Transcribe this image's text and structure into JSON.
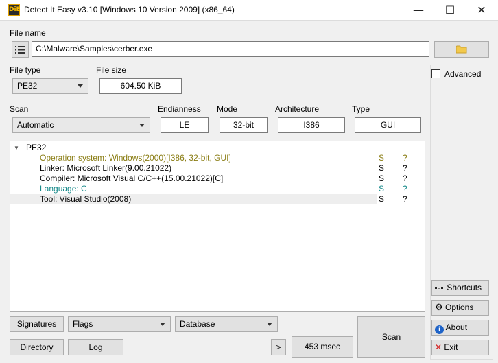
{
  "window": {
    "title": "Detect It Easy v3.10 [Windows 10 Version 2009] (x86_64)",
    "icon_text": "DiE",
    "minimize": "—",
    "maximize": "☐",
    "close": "✕"
  },
  "file": {
    "label": "File name",
    "path": "C:\\Malware\\Samples\\cerber.exe",
    "menu_icon": "list-icon",
    "open_icon": "folder-icon"
  },
  "file_type": {
    "label": "File type",
    "value": "PE32"
  },
  "file_size": {
    "label": "File size",
    "value": "604.50 KiB"
  },
  "scan": {
    "label": "Scan",
    "value": "Automatic"
  },
  "endianness": {
    "label": "Endianness",
    "value": "LE"
  },
  "mode": {
    "label": "Mode",
    "value": "32-bit"
  },
  "architecture": {
    "label": "Architecture",
    "value": "I386"
  },
  "type": {
    "label": "Type",
    "value": "GUI"
  },
  "tree": {
    "root": "PE32",
    "expander": "▼",
    "rows": [
      {
        "text": "Operation system: Windows(2000)[I386, 32-bit, GUI]",
        "flag": "S",
        "info": "?",
        "color": "#8a7d14"
      },
      {
        "text": "Linker: Microsoft Linker(9.00.21022)",
        "flag": "S",
        "info": "?",
        "color": "#000000"
      },
      {
        "text": "Compiler: Microsoft Visual C/C++(15.00.21022)[C]",
        "flag": "S",
        "info": "?",
        "color": "#000000"
      },
      {
        "text": "Language: C",
        "flag": "S",
        "info": "?",
        "color": "#178a8a"
      },
      {
        "text": "Tool: Visual Studio(2008)",
        "flag": "S",
        "info": "?",
        "color": "#000000"
      }
    ]
  },
  "advanced": {
    "label": "Advanced",
    "checked": false
  },
  "buttons": {
    "shortcuts": "Shortcuts",
    "options": "Options",
    "about": "About",
    "exit": "Exit",
    "signatures": "Signatures",
    "flags": "Flags",
    "database": "Database",
    "directory": "Directory",
    "log": "Log",
    "more": ">",
    "time": "453 msec",
    "scan": "Scan"
  },
  "colors": {
    "os_text": "#8a7d14",
    "language_text": "#178a8a",
    "about_icon": "#1e63c8",
    "exit_icon": "#d42020"
  }
}
